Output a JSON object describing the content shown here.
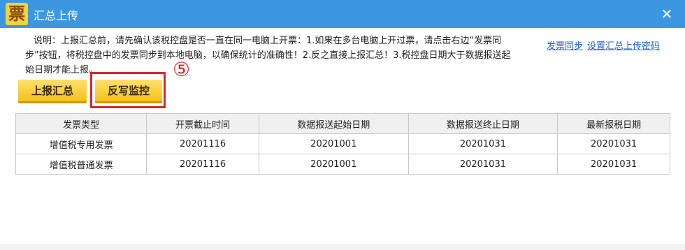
{
  "window": {
    "icon_glyph": "票",
    "title": "汇总上传",
    "close_glyph": "✕"
  },
  "notice": {
    "lines": [
      "说明：上报汇总前，请先确认该税控盘是否一直在同一电脑上开票：1.如果在多台电脑上开过票，请点击右边“发票同",
      "步”按钮，将税控盘中的发票同步到本地电脑，以确保统计的准确性！2.反之直接上报汇总！3.税控盘日期大于数据报送起",
      "始日期才能上报。"
    ]
  },
  "links": {
    "sync": "发票同步",
    "settings": "设置汇总上传密码"
  },
  "buttons": {
    "report": "上报汇总",
    "writeback": "反写监控"
  },
  "annotation": {
    "step": "⑤",
    "color": "#d9262b"
  },
  "table": {
    "headers": [
      "发票类型",
      "开票截止时间",
      "数据报送起始日期",
      "数据报送终止日期",
      "最新报税日期"
    ],
    "rows": [
      [
        "增值税专用发票",
        "20201116",
        "20201001",
        "20201031",
        "20201031"
      ],
      [
        "增值税普通发票",
        "20201116",
        "20201001",
        "20201031",
        "20201031"
      ]
    ]
  },
  "colors": {
    "titlebar": "#3d97e0",
    "button": "#f5c21b",
    "link": "#1c5fd1"
  }
}
